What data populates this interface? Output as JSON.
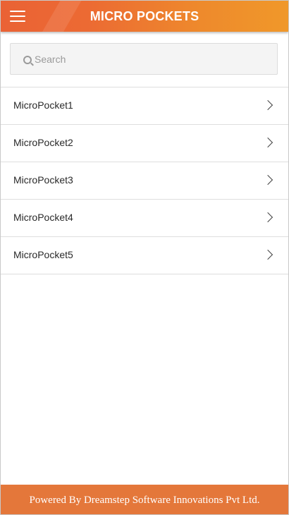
{
  "header": {
    "title": "MICRO POCKETS",
    "menu_icon": "hamburger-menu-icon",
    "gradient_start": "#ea6235",
    "gradient_end": "#f0982a"
  },
  "search": {
    "placeholder": "Search",
    "value": "",
    "icon": "search-icon"
  },
  "list": {
    "items": [
      {
        "label": "MicroPocket1",
        "icon": "chevron-right-icon"
      },
      {
        "label": "MicroPocket2",
        "icon": "chevron-right-icon"
      },
      {
        "label": "MicroPocket3",
        "icon": "chevron-right-icon"
      },
      {
        "label": "MicroPocket4",
        "icon": "chevron-right-icon"
      },
      {
        "label": "MicroPocket5",
        "icon": "chevron-right-icon"
      }
    ]
  },
  "footer": {
    "text": "Powered By Dreamstep Software Innovations Pvt Ltd.",
    "color": "#e4773a"
  }
}
